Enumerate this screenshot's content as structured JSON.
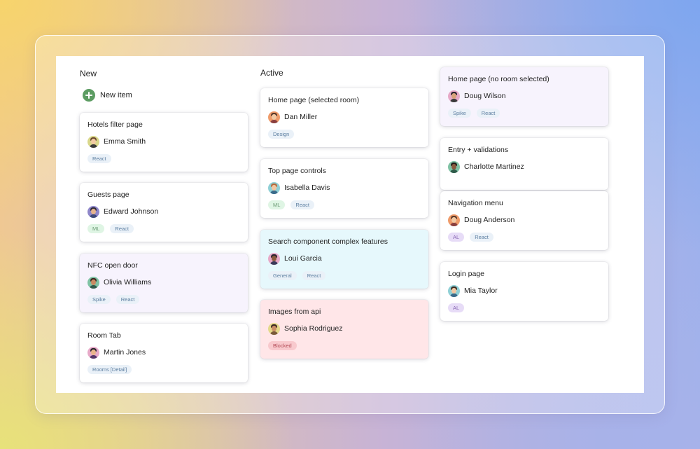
{
  "columns": [
    {
      "title": "New",
      "new_item_label": "New item",
      "cards": [
        {
          "title": "Hotels filter page",
          "person": "Emma Smith",
          "tags": [
            "React"
          ]
        },
        {
          "title": "Guests page",
          "person": "Edward Johnson",
          "tags": [
            "ML",
            "React"
          ]
        },
        {
          "title": "NFC open door",
          "person": "Olivia Williams",
          "tags": [
            "Spike",
            "React"
          ]
        },
        {
          "title": "Room Tab",
          "person": "Martin Jones",
          "tags": [
            "Rooms [Detail]"
          ]
        }
      ]
    },
    {
      "title": "Active",
      "cards": [
        {
          "title": "Home page (selected room)",
          "person": "Dan Miller",
          "tags": [
            "Design"
          ]
        },
        {
          "title": "Top page controls",
          "person": "Isabella Davis",
          "tags": [
            "ML",
            "React"
          ]
        },
        {
          "title": "Search component complex features",
          "person": "Loui Garcia",
          "tags": [
            "General",
            "React"
          ]
        },
        {
          "title": "Images from api",
          "person": "Sophia Rodriguez",
          "tags": [
            "Blocked"
          ]
        }
      ]
    },
    {
      "title": "",
      "cards": [
        {
          "title": "Home page (no room selected)",
          "person": "Doug Wilson",
          "tags": [
            "Spike",
            "React"
          ]
        },
        {
          "title": "Entry + validations",
          "person": "Charlotte Martinez",
          "tags": []
        },
        {
          "title": "Navigation menu",
          "person": "Doug Anderson",
          "tags": [
            "AL",
            "React"
          ]
        },
        {
          "title": "Login page",
          "person": "Mia Taylor",
          "tags": [
            "AL"
          ]
        }
      ]
    }
  ],
  "colors": {
    "new_item_icon": "#5c9c62",
    "card_lavender": "#f7f3fd",
    "card_cyan": "#e6f8fc",
    "card_pink": "#ffe6e8",
    "tag_blocked": "#f8c9cd"
  }
}
